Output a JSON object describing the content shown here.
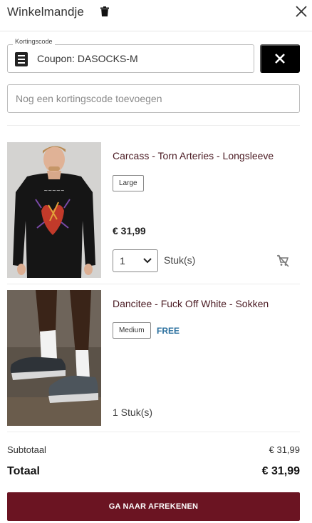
{
  "header": {
    "title": "Winkelmandje",
    "trash_icon": "trash-icon",
    "close_icon": "close-icon"
  },
  "coupon": {
    "legend": "Kortingscode",
    "value": "Coupon: DASOCKS-M",
    "icon": "list-icon",
    "remove_icon": "close-icon"
  },
  "add_coupon": {
    "placeholder": "Nog een kortingscode toevoegen"
  },
  "items": [
    {
      "name": "Carcass - Torn Arteries - Longsleeve",
      "size": "Large",
      "price": "€ 31,99",
      "quantity": "1",
      "unit": "Stuk(s)",
      "remove_icon": "cart-remove-icon"
    },
    {
      "name": "Dancitee - Fuck Off White - Sokken",
      "size": "Medium",
      "badge": "FREE",
      "quantity_text": "1 Stuk(s)"
    }
  ],
  "summary": {
    "subtotal_label": "Subtotaal",
    "subtotal_value": "€ 31,99",
    "total_label": "Totaal",
    "total_value": "€ 31,99"
  },
  "checkout": {
    "label": "GA NAAR AFREKENEN"
  },
  "colors": {
    "brand": "#6b1422",
    "free": "#2a6f9e",
    "product_name": "#4a1a22"
  }
}
